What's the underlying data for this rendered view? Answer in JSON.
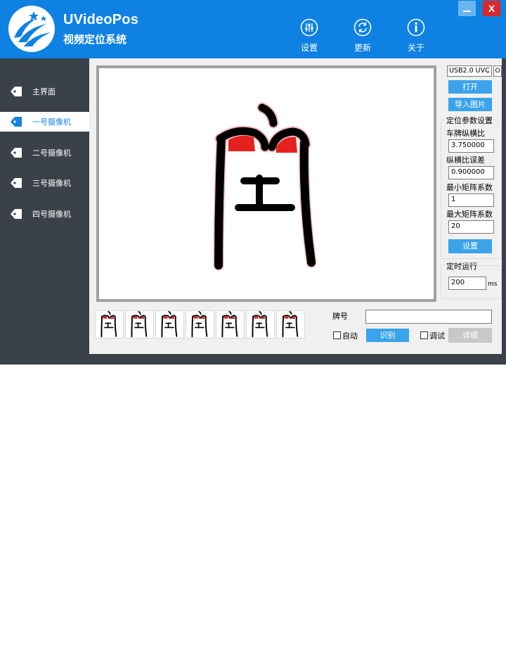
{
  "header": {
    "title": "UVideoPos",
    "subtitle": "视频定位系统",
    "buttons": {
      "settings": "设置",
      "update": "更新",
      "about": "关于"
    },
    "window": {
      "close": "X"
    }
  },
  "sidebar": {
    "items": [
      {
        "label": "主界面",
        "active": false
      },
      {
        "label": "一号摄像机",
        "active": true
      },
      {
        "label": "二号摄像机",
        "active": false
      },
      {
        "label": "三号摄像机",
        "active": false
      },
      {
        "label": "四号摄像机",
        "active": false
      }
    ]
  },
  "video": {
    "character": "空",
    "thumbnail_count": 7
  },
  "plate": {
    "label": "牌号",
    "value": "",
    "auto_label": "自动",
    "recognize_label": "识别",
    "debug_label": "调试",
    "detail_label": "详细"
  },
  "device": {
    "selected": "USB2.0 UVC",
    "option_button": "O",
    "open_label": "打开",
    "import_label": "导入图片"
  },
  "params": {
    "group_label": "定位参数设置",
    "aspect_label": "车牌纵横比",
    "aspect_value": "3.750000",
    "error_label": "纵横比误差",
    "error_value": "0.900000",
    "min_label": "最小矩阵系数",
    "min_value": "1",
    "max_label": "最大矩阵系数",
    "max_value": "20",
    "set_label": "设置"
  },
  "timer": {
    "group_label": "定时运行",
    "value": "200",
    "unit": "ms"
  },
  "colors": {
    "header_bg": "#0e81e3",
    "sidebar_bg": "#3a4149",
    "accent_blue": "#3aa3e9",
    "close_red": "#d9282a"
  }
}
